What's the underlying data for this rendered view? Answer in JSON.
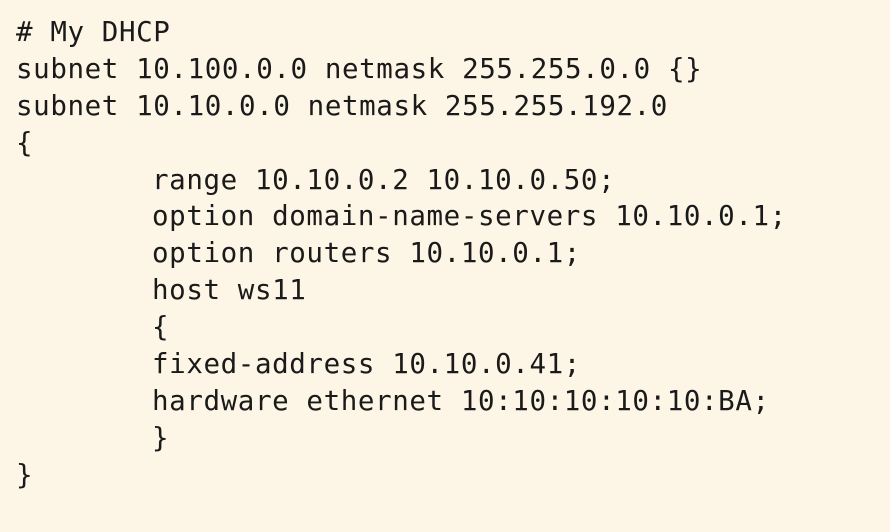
{
  "document": {
    "background": "#fdf6e6",
    "text_color": "#1a1a1a",
    "lines": [
      {
        "text": "# My DHCP"
      },
      {
        "text": "subnet 10.100.0.0 netmask 255.255.0.0 {}"
      },
      {
        "text": "subnet 10.10.0.0 netmask 255.255.192.0"
      },
      {
        "text": "{"
      },
      {
        "text": "range 10.10.0.2 10.10.0.50;"
      },
      {
        "text": "option domain-name-servers 10.10.0.1;"
      },
      {
        "text": "option routers 10.10.0.1;"
      },
      {
        "text": "host ws11"
      },
      {
        "text": "{"
      },
      {
        "text": "fixed-address 10.10.0.41;"
      },
      {
        "text": "hardware ethernet 10:10:10:10:10:BA;"
      },
      {
        "text": "}"
      },
      {
        "text": "}"
      }
    ]
  }
}
